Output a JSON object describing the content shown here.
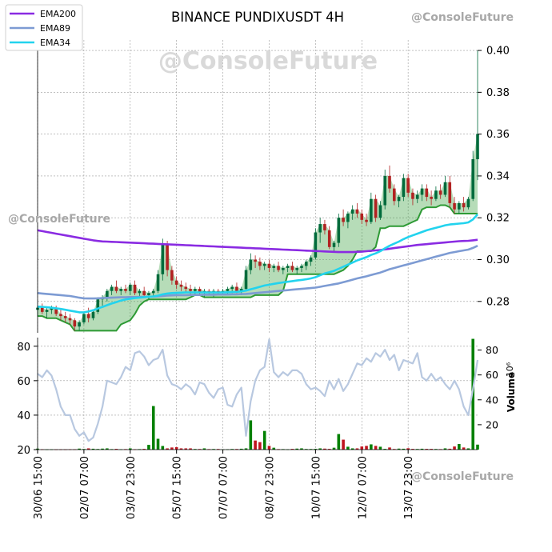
{
  "chart_data": [
    {
      "type": "candlestick",
      "title": "BINANCE PUNDIXUSDT 4H",
      "ylim": [
        0.265,
        0.405
      ],
      "y_ticks": [
        "0.28",
        "0.30",
        "0.32",
        "0.34",
        "0.36",
        "0.38",
        "0.40"
      ],
      "grid": true,
      "legend_position": "top-left",
      "legend": [
        {
          "name": "EMA200",
          "color": "#8a2be2"
        },
        {
          "name": "EMA89",
          "color": "#7d9bd3"
        },
        {
          "name": "EMA34",
          "color": "#22d3ee"
        }
      ],
      "ohlc": [
        [
          0.276,
          0.278,
          0.273,
          0.277
        ],
        [
          0.277,
          0.279,
          0.274,
          0.275
        ],
        [
          0.275,
          0.277,
          0.272,
          0.276
        ],
        [
          0.276,
          0.278,
          0.274,
          0.277
        ],
        [
          0.277,
          0.278,
          0.273,
          0.274
        ],
        [
          0.274,
          0.276,
          0.271,
          0.273
        ],
        [
          0.273,
          0.275,
          0.27,
          0.272
        ],
        [
          0.272,
          0.274,
          0.269,
          0.271
        ],
        [
          0.271,
          0.272,
          0.266,
          0.268
        ],
        [
          0.268,
          0.271,
          0.266,
          0.27
        ],
        [
          0.27,
          0.275,
          0.269,
          0.274
        ],
        [
          0.274,
          0.277,
          0.27,
          0.272
        ],
        [
          0.272,
          0.276,
          0.271,
          0.275
        ],
        [
          0.275,
          0.282,
          0.274,
          0.281
        ],
        [
          0.281,
          0.283,
          0.278,
          0.282
        ],
        [
          0.282,
          0.286,
          0.28,
          0.285
        ],
        [
          0.285,
          0.288,
          0.283,
          0.287
        ],
        [
          0.287,
          0.29,
          0.284,
          0.285
        ],
        [
          0.285,
          0.287,
          0.283,
          0.286
        ],
        [
          0.286,
          0.288,
          0.284,
          0.285
        ],
        [
          0.285,
          0.289,
          0.283,
          0.288
        ],
        [
          0.288,
          0.29,
          0.283,
          0.284
        ],
        [
          0.284,
          0.286,
          0.282,
          0.285
        ],
        [
          0.285,
          0.287,
          0.282,
          0.283
        ],
        [
          0.283,
          0.285,
          0.281,
          0.284
        ],
        [
          0.284,
          0.286,
          0.282,
          0.285
        ],
        [
          0.285,
          0.295,
          0.284,
          0.293
        ],
        [
          0.293,
          0.31,
          0.29,
          0.307
        ],
        [
          0.307,
          0.309,
          0.292,
          0.295
        ],
        [
          0.295,
          0.297,
          0.288,
          0.29
        ],
        [
          0.29,
          0.292,
          0.286,
          0.288
        ],
        [
          0.288,
          0.29,
          0.285,
          0.287
        ],
        [
          0.287,
          0.289,
          0.284,
          0.286
        ],
        [
          0.286,
          0.288,
          0.283,
          0.285
        ],
        [
          0.285,
          0.287,
          0.283,
          0.286
        ],
        [
          0.286,
          0.287,
          0.283,
          0.284
        ],
        [
          0.284,
          0.286,
          0.282,
          0.285
        ],
        [
          0.285,
          0.286,
          0.283,
          0.284
        ],
        [
          0.284,
          0.286,
          0.282,
          0.285
        ],
        [
          0.285,
          0.286,
          0.283,
          0.284
        ],
        [
          0.284,
          0.286,
          0.283,
          0.285
        ],
        [
          0.285,
          0.287,
          0.283,
          0.286
        ],
        [
          0.286,
          0.288,
          0.284,
          0.287
        ],
        [
          0.287,
          0.289,
          0.284,
          0.285
        ],
        [
          0.285,
          0.287,
          0.283,
          0.286
        ],
        [
          0.286,
          0.297,
          0.285,
          0.295
        ],
        [
          0.295,
          0.303,
          0.293,
          0.3
        ],
        [
          0.3,
          0.302,
          0.296,
          0.299
        ],
        [
          0.299,
          0.301,
          0.295,
          0.297
        ],
        [
          0.297,
          0.299,
          0.295,
          0.298
        ],
        [
          0.298,
          0.3,
          0.294,
          0.296
        ],
        [
          0.296,
          0.298,
          0.294,
          0.297
        ],
        [
          0.297,
          0.299,
          0.294,
          0.295
        ],
        [
          0.295,
          0.297,
          0.293,
          0.296
        ],
        [
          0.296,
          0.298,
          0.294,
          0.297
        ],
        [
          0.297,
          0.299,
          0.294,
          0.295
        ],
        [
          0.295,
          0.297,
          0.293,
          0.296
        ],
        [
          0.296,
          0.298,
          0.294,
          0.297
        ],
        [
          0.297,
          0.3,
          0.295,
          0.299
        ],
        [
          0.299,
          0.302,
          0.297,
          0.301
        ],
        [
          0.301,
          0.315,
          0.3,
          0.313
        ],
        [
          0.313,
          0.32,
          0.308,
          0.317
        ],
        [
          0.317,
          0.319,
          0.312,
          0.314
        ],
        [
          0.314,
          0.316,
          0.305,
          0.306
        ],
        [
          0.306,
          0.309,
          0.304,
          0.308
        ],
        [
          0.308,
          0.322,
          0.306,
          0.32
        ],
        [
          0.32,
          0.324,
          0.316,
          0.318
        ],
        [
          0.318,
          0.323,
          0.315,
          0.322
        ],
        [
          0.322,
          0.326,
          0.319,
          0.324
        ],
        [
          0.324,
          0.327,
          0.32,
          0.322
        ],
        [
          0.322,
          0.324,
          0.317,
          0.319
        ],
        [
          0.319,
          0.322,
          0.316,
          0.318
        ],
        [
          0.318,
          0.332,
          0.317,
          0.329
        ],
        [
          0.329,
          0.331,
          0.318,
          0.32
        ],
        [
          0.32,
          0.328,
          0.319,
          0.326
        ],
        [
          0.326,
          0.343,
          0.324,
          0.34
        ],
        [
          0.34,
          0.345,
          0.332,
          0.334
        ],
        [
          0.334,
          0.336,
          0.326,
          0.328
        ],
        [
          0.328,
          0.331,
          0.325,
          0.33
        ],
        [
          0.33,
          0.341,
          0.328,
          0.339
        ],
        [
          0.339,
          0.341,
          0.33,
          0.332
        ],
        [
          0.332,
          0.334,
          0.326,
          0.329
        ],
        [
          0.329,
          0.333,
          0.327,
          0.331
        ],
        [
          0.331,
          0.336,
          0.328,
          0.334
        ],
        [
          0.334,
          0.336,
          0.328,
          0.33
        ],
        [
          0.33,
          0.333,
          0.326,
          0.329
        ],
        [
          0.329,
          0.335,
          0.328,
          0.333
        ],
        [
          0.333,
          0.336,
          0.329,
          0.331
        ],
        [
          0.331,
          0.34,
          0.33,
          0.337
        ],
        [
          0.337,
          0.34,
          0.325,
          0.327
        ],
        [
          0.327,
          0.33,
          0.322,
          0.324
        ],
        [
          0.324,
          0.328,
          0.322,
          0.327
        ],
        [
          0.327,
          0.33,
          0.323,
          0.325
        ],
        [
          0.325,
          0.33,
          0.324,
          0.329
        ],
        [
          0.329,
          0.352,
          0.328,
          0.348
        ],
        [
          0.348,
          0.4,
          0.338,
          0.36
        ]
      ],
      "ema200": [
        0.314,
        0.3136,
        0.3132,
        0.3128,
        0.3124,
        0.312,
        0.3116,
        0.3112,
        0.3108,
        0.3104,
        0.31,
        0.3096,
        0.3092,
        0.3089,
        0.3087,
        0.3086,
        0.3085,
        0.3084,
        0.3083,
        0.3082,
        0.3081,
        0.308,
        0.3079,
        0.3078,
        0.3077,
        0.3076,
        0.3075,
        0.3074,
        0.3073,
        0.3072,
        0.3071,
        0.307,
        0.3069,
        0.3068,
        0.3067,
        0.3066,
        0.3065,
        0.3064,
        0.3063,
        0.3062,
        0.3061,
        0.306,
        0.3059,
        0.3058,
        0.3057,
        0.3056,
        0.3055,
        0.3054,
        0.3053,
        0.3052,
        0.3051,
        0.305,
        0.3049,
        0.3048,
        0.3047,
        0.3046,
        0.3045,
        0.3044,
        0.3043,
        0.3042,
        0.3041,
        0.304,
        0.3039,
        0.3038,
        0.3037,
        0.3036,
        0.3036,
        0.3036,
        0.3036,
        0.3037,
        0.3038,
        0.304,
        0.3042,
        0.3044,
        0.3046,
        0.3049,
        0.3052,
        0.3055,
        0.3058,
        0.3061,
        0.3064,
        0.3067,
        0.307,
        0.3072,
        0.3074,
        0.3076,
        0.3078,
        0.308,
        0.3082,
        0.3084,
        0.3086,
        0.3088,
        0.3089,
        0.309,
        0.3092,
        0.3095
      ],
      "ema89": [
        0.284,
        0.2838,
        0.2836,
        0.2834,
        0.2832,
        0.283,
        0.2828,
        0.2826,
        0.2822,
        0.2818,
        0.2815,
        0.2814,
        0.2814,
        0.2815,
        0.2816,
        0.2817,
        0.2818,
        0.2819,
        0.282,
        0.282,
        0.2821,
        0.2821,
        0.2822,
        0.2822,
        0.2823,
        0.2823,
        0.2824,
        0.2826,
        0.2828,
        0.2829,
        0.283,
        0.283,
        0.283,
        0.2831,
        0.2831,
        0.2831,
        0.2832,
        0.2832,
        0.2832,
        0.2833,
        0.2833,
        0.2833,
        0.2834,
        0.2834,
        0.2835,
        0.2836,
        0.2838,
        0.284,
        0.2842,
        0.2844,
        0.2846,
        0.2848,
        0.285,
        0.2852,
        0.2854,
        0.2856,
        0.2858,
        0.286,
        0.2862,
        0.2864,
        0.2866,
        0.287,
        0.2874,
        0.2878,
        0.2882,
        0.2886,
        0.2892,
        0.2898,
        0.2904,
        0.291,
        0.2915,
        0.292,
        0.2926,
        0.2932,
        0.2938,
        0.2946,
        0.2954,
        0.296,
        0.2966,
        0.2972,
        0.2978,
        0.2984,
        0.299,
        0.2996,
        0.3002,
        0.3008,
        0.3014,
        0.302,
        0.3026,
        0.3032,
        0.3036,
        0.304,
        0.3044,
        0.3048,
        0.3056,
        0.3066
      ],
      "ema34": [
        0.2775,
        0.2774,
        0.2772,
        0.277,
        0.2767,
        0.2764,
        0.276,
        0.2756,
        0.2752,
        0.2748,
        0.2748,
        0.2752,
        0.2758,
        0.2766,
        0.2774,
        0.2782,
        0.279,
        0.2797,
        0.2804,
        0.2809,
        0.2813,
        0.2816,
        0.2818,
        0.282,
        0.2822,
        0.2824,
        0.2828,
        0.2834,
        0.2838,
        0.284,
        0.2841,
        0.2842,
        0.2843,
        0.2843,
        0.2843,
        0.2843,
        0.2843,
        0.2843,
        0.2843,
        0.2843,
        0.2843,
        0.2844,
        0.2845,
        0.2846,
        0.2848,
        0.2852,
        0.2858,
        0.2864,
        0.287,
        0.2876,
        0.288,
        0.2884,
        0.2888,
        0.2891,
        0.2894,
        0.2897,
        0.29,
        0.2903,
        0.2906,
        0.291,
        0.2916,
        0.2925,
        0.2934,
        0.294,
        0.2946,
        0.2956,
        0.2966,
        0.2976,
        0.2986,
        0.2996,
        0.3004,
        0.3012,
        0.3022,
        0.303,
        0.304,
        0.3054,
        0.3066,
        0.3076,
        0.3086,
        0.3098,
        0.3108,
        0.3116,
        0.3124,
        0.3132,
        0.314,
        0.3146,
        0.3152,
        0.3158,
        0.3164,
        0.3168,
        0.317,
        0.3172,
        0.3174,
        0.3178,
        0.3192,
        0.3216
      ]
    },
    {
      "type": "line+bar",
      "x_ticks": [
        "30/06 15:00",
        "02/07 07:00",
        "03/07 23:00",
        "05/07 15:00",
        "07/07 07:00",
        "08/07 23:00",
        "10/07 15:00",
        "12/07 07:00",
        "13/07 23:00"
      ],
      "left_axis": {
        "ylim": [
          20,
          85
        ],
        "ticks": [
          "20",
          "40",
          "60",
          "80"
        ]
      },
      "right_axis": {
        "label": "Volume",
        "unit": "10⁶",
        "ylim": [
          0,
          90
        ],
        "ticks": [
          "20",
          "40",
          "60",
          "80"
        ]
      },
      "rsi": [
        64,
        62,
        66,
        63,
        55,
        45,
        40,
        40,
        32,
        28,
        30,
        25,
        27,
        35,
        45,
        60,
        59,
        58,
        62,
        68,
        66,
        76,
        77,
        74,
        69,
        72,
        73,
        78,
        63,
        58,
        57,
        55,
        58,
        56,
        52,
        59,
        58,
        53,
        50,
        55,
        56,
        46,
        45,
        52,
        56,
        28,
        48,
        60,
        66,
        68,
        84,
        65,
        62,
        65,
        63,
        66,
        66,
        64,
        58,
        55,
        56,
        54,
        51,
        60,
        55,
        61,
        54,
        58,
        64,
        70,
        69,
        73,
        71,
        76,
        74,
        78,
        72,
        75,
        66,
        72,
        71,
        70,
        76,
        62,
        60,
        64,
        60,
        62,
        58,
        55,
        60,
        55,
        45,
        40,
        55,
        72
      ],
      "volume": [
        0.8,
        0.3,
        0.2,
        0.2,
        0.2,
        0.2,
        0.2,
        0.3,
        0.3,
        0.8,
        0.5,
        1.0,
        0.7,
        0.5,
        0.8,
        1.0,
        0.4,
        0.6,
        0.3,
        0.4,
        1.0,
        0.3,
        0.4,
        0.6,
        3.8,
        35.0,
        8.7,
        2.9,
        1.0,
        1.7,
        2.0,
        1.0,
        1.0,
        1.0,
        0.5,
        0.5,
        1.0,
        0.4,
        0.5,
        0.5,
        0.2,
        0.3,
        0.5,
        0.5,
        0.7,
        1.0,
        23.5,
        7.3,
        6.0,
        15.0,
        3.0,
        1.5,
        0.4,
        0.4,
        0.3,
        0.6,
        0.8,
        1.0,
        0.5,
        0.5,
        0.6,
        1.0,
        0.8,
        0.6,
        1.5,
        12.5,
        8.0,
        2.3,
        1.0,
        1.0,
        2.5,
        3.0,
        4.2,
        3.0,
        2.3,
        0.6,
        1.7,
        0.5,
        0.8,
        0.7,
        1.1,
        0.6,
        0.5,
        0.7,
        0.6,
        0.6,
        0.5,
        0.4,
        1.0,
        0.7,
        2.5,
        4.5,
        1.7,
        1.0,
        89.0,
        4.0
      ]
    }
  ],
  "watermark": "@ConsoleFuture",
  "colors": {
    "up": "#006b3c",
    "down": "#b22222",
    "vol_up": "#008000",
    "vol_down": "#c0141f",
    "ribbon": "#2e9a35",
    "rsi": "#b8c8e0"
  }
}
